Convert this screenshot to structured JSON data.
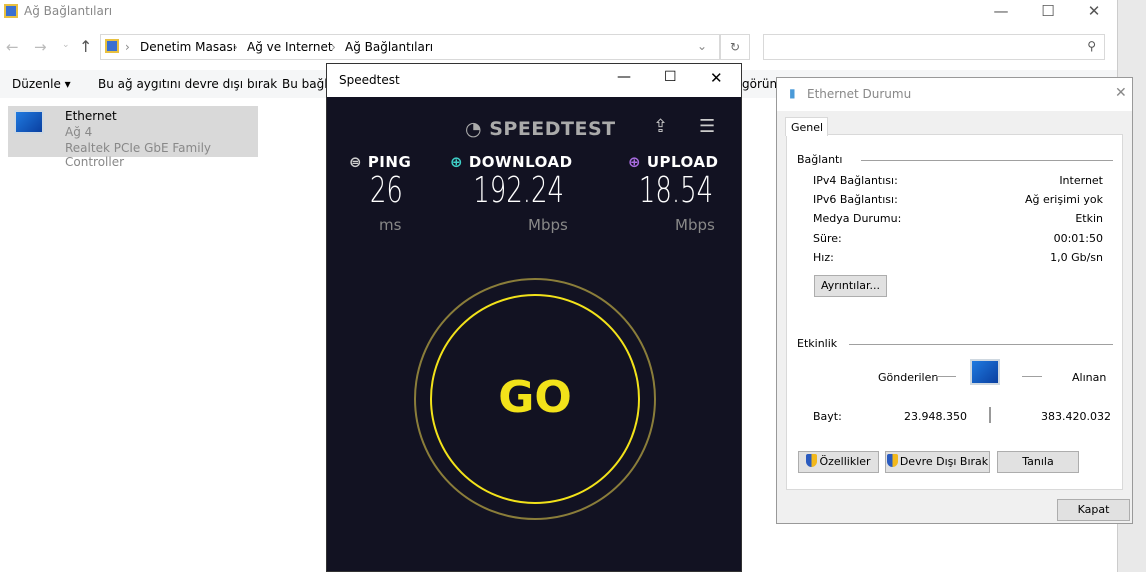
{
  "explorer": {
    "title": "Ağ Bağlantıları",
    "breadcrumb": [
      "Denetim Masası",
      "Ağ ve Internet",
      "Ağ Bağlantıları"
    ],
    "search_placeholder": "",
    "toolbar": {
      "organize": "Düzenle",
      "disable": "Bu ağ aygıtını devre dışı bırak",
      "diagnose_partial": "Bu bağla",
      "view_partial": "görün"
    },
    "item": {
      "name": "Ethernet",
      "network": "Ağ 4",
      "adapter": "Realtek PCIe GbE Family Controller"
    }
  },
  "speedtest": {
    "title": "Speedtest",
    "logo": "SPEEDTEST",
    "ping": {
      "label": "PING",
      "value": "26",
      "unit": "ms"
    },
    "download": {
      "label": "DOWNLOAD",
      "value": "192.24",
      "unit": "Mbps"
    },
    "upload": {
      "label": "UPLOAD",
      "value": "18.54",
      "unit": "Mbps"
    },
    "go": "GO",
    "colors": {
      "ping": "#cfcfcf",
      "download": "#3fd0c8",
      "upload": "#a86ce0",
      "go": "#f2e21a"
    }
  },
  "status": {
    "title": "Ethernet Durumu",
    "tab": "Genel",
    "connection_header": "Bağlantı",
    "rows": [
      {
        "label": "IPv4 Bağlantısı:",
        "value": "Internet"
      },
      {
        "label": "IPv6 Bağlantısı:",
        "value": "Ağ erişimi yok"
      },
      {
        "label": "Medya Durumu:",
        "value": "Etkin"
      },
      {
        "label": "Süre:",
        "value": "00:01:50"
      },
      {
        "label": "Hız:",
        "value": "1,0 Gb/sn"
      }
    ],
    "details": "Ayrıntılar...",
    "activity_header": "Etkinlik",
    "sent": "Gönderilen",
    "received": "Alınan",
    "bytes_label": "Bayt:",
    "bytes_sent": "23.948.350",
    "bytes_received": "383.420.032",
    "properties": "Özellikler",
    "disable": "Devre Dışı Bırak",
    "diagnose": "Tanıla",
    "close": "Kapat"
  }
}
